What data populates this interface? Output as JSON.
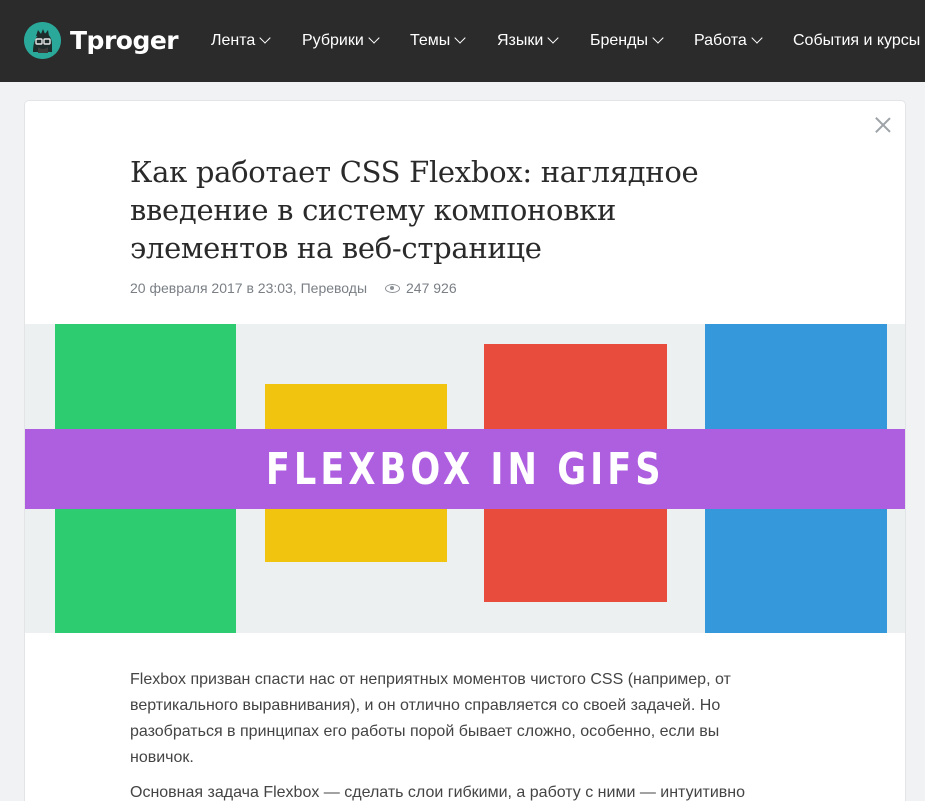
{
  "header": {
    "logo_text": "Tproger",
    "nav": [
      "Лента",
      "Рубрики",
      "Темы",
      "Языки",
      "Бренды",
      "Работа",
      "События и курсы"
    ]
  },
  "article": {
    "title_lines": [
      "Как работает CSS Flexbox: наглядное",
      "введение в систему компоновки",
      "элементов на веб-странице"
    ],
    "meta": "20 февраля 2017 в 23:03, Переводы",
    "views": "247 926",
    "hero": {
      "banner_text": "FLEXBOX IN GIFS",
      "colors": {
        "green": "#2ecc71",
        "yellow": "#f1c40f",
        "red": "#e74c3c",
        "blue": "#3498db",
        "purple": "#ae5fe0",
        "background": "#ecf0f1"
      }
    },
    "paragraphs": [
      "Flexbox призван спасти нас от неприятных моментов чистого CSS (например, от вертикального выравнивания), и он отлично справляется со своей задачей. Но разобраться в принципах его работы порой бывает сложно, особенно, если вы новичок.",
      "Основная задача Flexbox — сделать слои гибкими, а работу с ними — интуитивно"
    ]
  }
}
